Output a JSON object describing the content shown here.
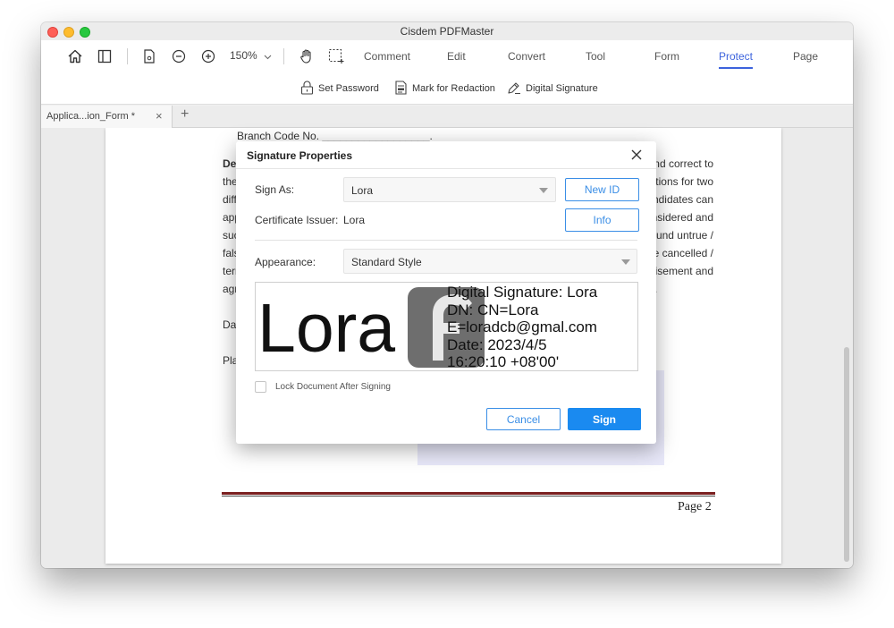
{
  "window": {
    "title": "Cisdem PDFMaster"
  },
  "toolbar": {
    "zoom": "150%",
    "menu": [
      {
        "label": "Comment",
        "active": false
      },
      {
        "label": "Edit",
        "active": false
      },
      {
        "label": "Convert",
        "active": false
      },
      {
        "label": "Tool",
        "active": false
      },
      {
        "label": "Form",
        "active": false
      },
      {
        "label": "Protect",
        "active": true
      },
      {
        "label": "Page",
        "active": false
      }
    ],
    "icons": [
      "home-icon",
      "sidebar-icon",
      "page-icon",
      "zoom-out-icon",
      "zoom-in-icon",
      "chevron-down-icon",
      "hand-icon",
      "select-icon"
    ]
  },
  "subtoolbar": {
    "set_password": "Set Password",
    "mark_redaction": "Mark for Redaction",
    "digital_signature": "Digital Signature"
  },
  "tabs": {
    "doc_tab_label": "Applica...ion_Form *",
    "close_symbol": "×",
    "add_symbol": "+"
  },
  "document": {
    "branch_line": "Branch Code No. __________________.",
    "left_fragments": [
      "De",
      "the",
      "diff",
      "app",
      "suc",
      "fals",
      "terr",
      "agr",
      "Da",
      "Pla"
    ],
    "right_fragments": [
      "nd correct to",
      "tions for two",
      "ndidates can",
      "nsidered and",
      "ound untrue /",
      "e cancelled /",
      "isement and",
      "."
    ],
    "page_label": "Page 2"
  },
  "dialog": {
    "title": "Signature Properties",
    "sign_as_label": "Sign As:",
    "sign_as_value": "Lora",
    "new_id_button": "New ID",
    "cert_issuer_label": "Certificate Issuer:",
    "cert_issuer_value": "Lora",
    "info_button": "Info",
    "appearance_label": "Appearance:",
    "appearance_value": "Standard Style",
    "preview": {
      "name": "Lora",
      "lines": [
        "Digital Signature: Lora",
        "DN: CN=Lora",
        "E=loradcb@gmal.com",
        "Date: 2023/4/5",
        "16:20:10 +08'00'"
      ]
    },
    "lock_label": "Lock Document After Signing",
    "lock_checked": false,
    "cancel_button": "Cancel",
    "sign_button": "Sign"
  },
  "colors": {
    "accent": "#3d63dd",
    "primary_button": "#1a8af0",
    "outline_button": "#3a8ee6"
  }
}
